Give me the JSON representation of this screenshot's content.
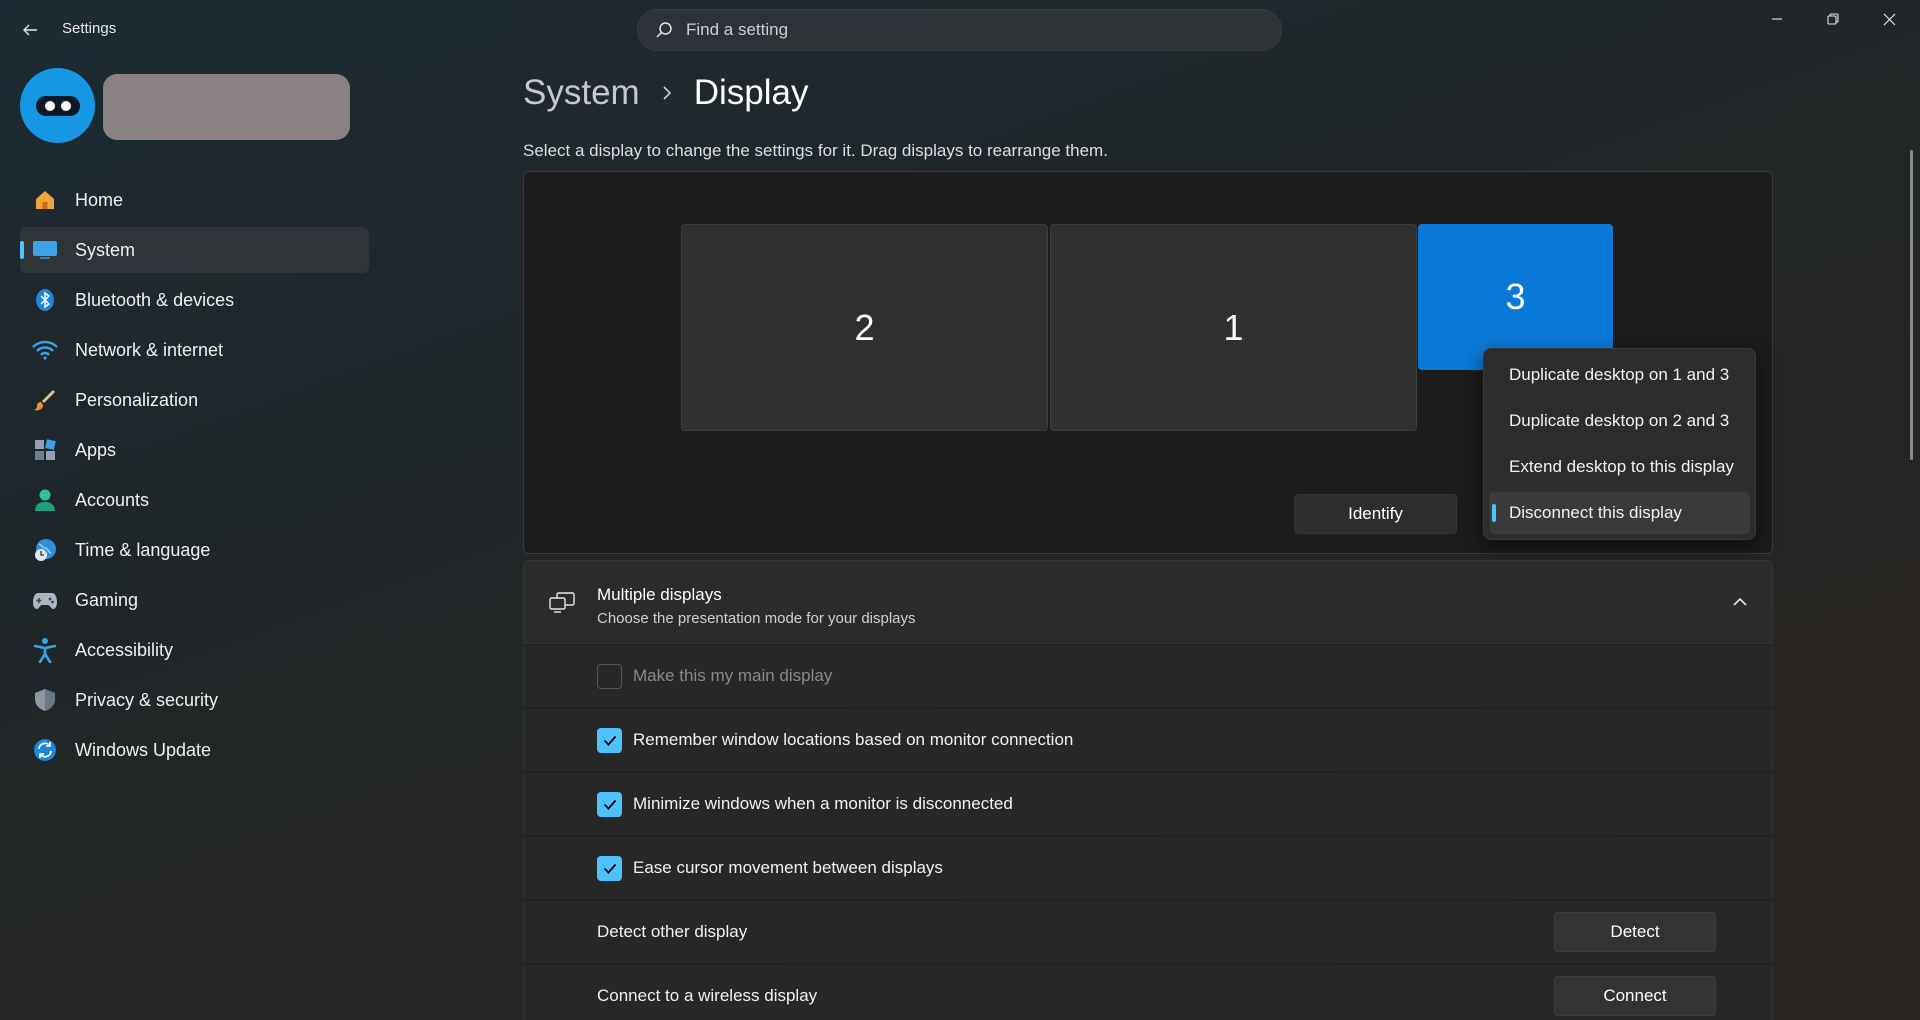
{
  "window": {
    "title": "Settings"
  },
  "search": {
    "placeholder": "Find a setting"
  },
  "sidebar": {
    "items": [
      {
        "label": "Home",
        "icon": "home-icon"
      },
      {
        "label": "System",
        "icon": "system-icon",
        "selected": true
      },
      {
        "label": "Bluetooth & devices",
        "icon": "bluetooth-icon"
      },
      {
        "label": "Network & internet",
        "icon": "wifi-icon"
      },
      {
        "label": "Personalization",
        "icon": "brush-icon"
      },
      {
        "label": "Apps",
        "icon": "apps-icon"
      },
      {
        "label": "Accounts",
        "icon": "accounts-icon"
      },
      {
        "label": "Time & language",
        "icon": "clock-globe-icon"
      },
      {
        "label": "Gaming",
        "icon": "gamepad-icon"
      },
      {
        "label": "Accessibility",
        "icon": "accessibility-icon"
      },
      {
        "label": "Privacy & security",
        "icon": "shield-icon"
      },
      {
        "label": "Windows Update",
        "icon": "update-icon"
      }
    ]
  },
  "breadcrumb": {
    "parent": "System",
    "current": "Display"
  },
  "intro_text": "Select a display to change the settings for it. Drag displays to rearrange them.",
  "arrangement": {
    "monitors": [
      "2",
      "1",
      "3"
    ],
    "identify_label": "Identify"
  },
  "flyout": {
    "items": [
      "Duplicate desktop on 1 and 3",
      "Duplicate desktop on 2 and 3",
      "Extend desktop to this display",
      "Disconnect this display"
    ]
  },
  "multiple_displays": {
    "title": "Multiple displays",
    "subtitle": "Choose the presentation mode for your displays",
    "options": [
      {
        "label": "Make this my main display",
        "checked": false,
        "disabled": true
      },
      {
        "label": "Remember window locations based on monitor connection",
        "checked": true
      },
      {
        "label": "Minimize windows when a monitor is disconnected",
        "checked": true
      },
      {
        "label": "Ease cursor movement between displays",
        "checked": true
      }
    ],
    "detect": {
      "label": "Detect other display",
      "button": "Detect"
    },
    "connect": {
      "label": "Connect to a wireless display",
      "button": "Connect"
    }
  },
  "colors": {
    "accent": "#4cc2ff",
    "selected_monitor": "#0a78d6",
    "avatar": "#1597e6"
  }
}
